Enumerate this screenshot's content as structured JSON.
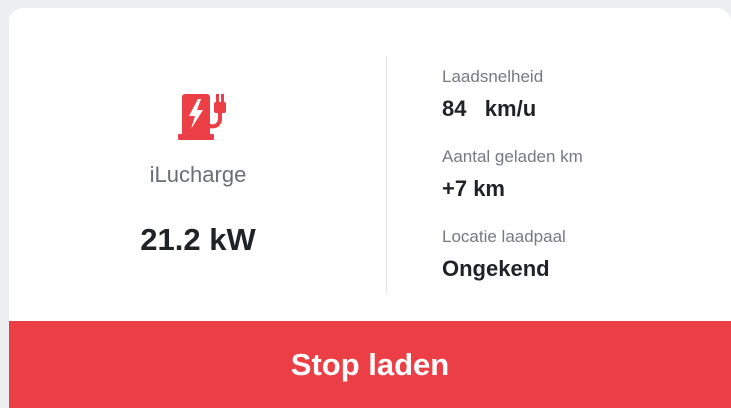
{
  "charger": {
    "icon": "ev-charger-plug-icon",
    "name": "iLucharge",
    "power": "21.2 kW"
  },
  "stats": {
    "charging_speed_label": "Laadsnelheid",
    "charging_speed_value": "84   km/u",
    "km_charged_label": "Aantal geladen km",
    "km_charged_value": "+7 km",
    "location_label": "Locatie laadpaal",
    "location_value": "Ongekend"
  },
  "actions": {
    "stop_label": "Stop laden"
  },
  "colors": {
    "accent": "#ec3f45",
    "background": "#ffffff",
    "text_primary": "#1f2227",
    "text_secondary": "#767a80"
  }
}
